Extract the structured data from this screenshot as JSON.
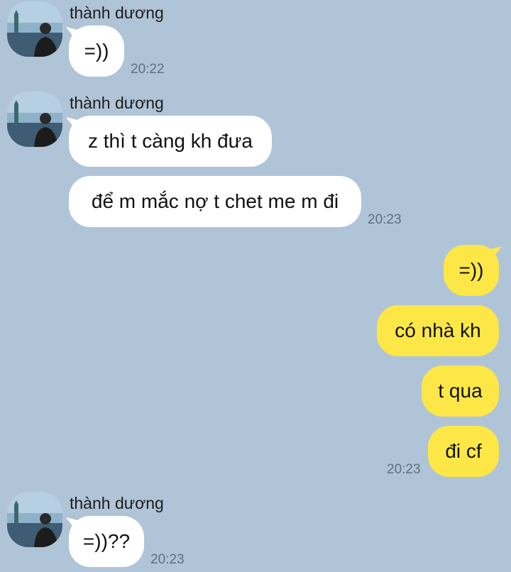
{
  "colors": {
    "background": "#b0c4d8",
    "incoming_bubble": "#ffffff",
    "outgoing_bubble": "#fde747",
    "timestamp": "#5e6e80"
  },
  "messages": {
    "group1": {
      "sender": "thành dương",
      "bubble1": "=))",
      "time": "20:22"
    },
    "group2": {
      "sender": "thành dương",
      "bubble1": "z thì t càng kh đưa",
      "bubble2": "để m mắc nợ t chet me m đi",
      "time": "20:23"
    },
    "group3": {
      "bubble1": "=))",
      "bubble2": "có nhà kh",
      "bubble3": "t qua",
      "bubble4": "đi cf",
      "time": "20:23"
    },
    "group4": {
      "sender": "thành dương",
      "bubble1": "=))??",
      "time": "20:23"
    }
  }
}
